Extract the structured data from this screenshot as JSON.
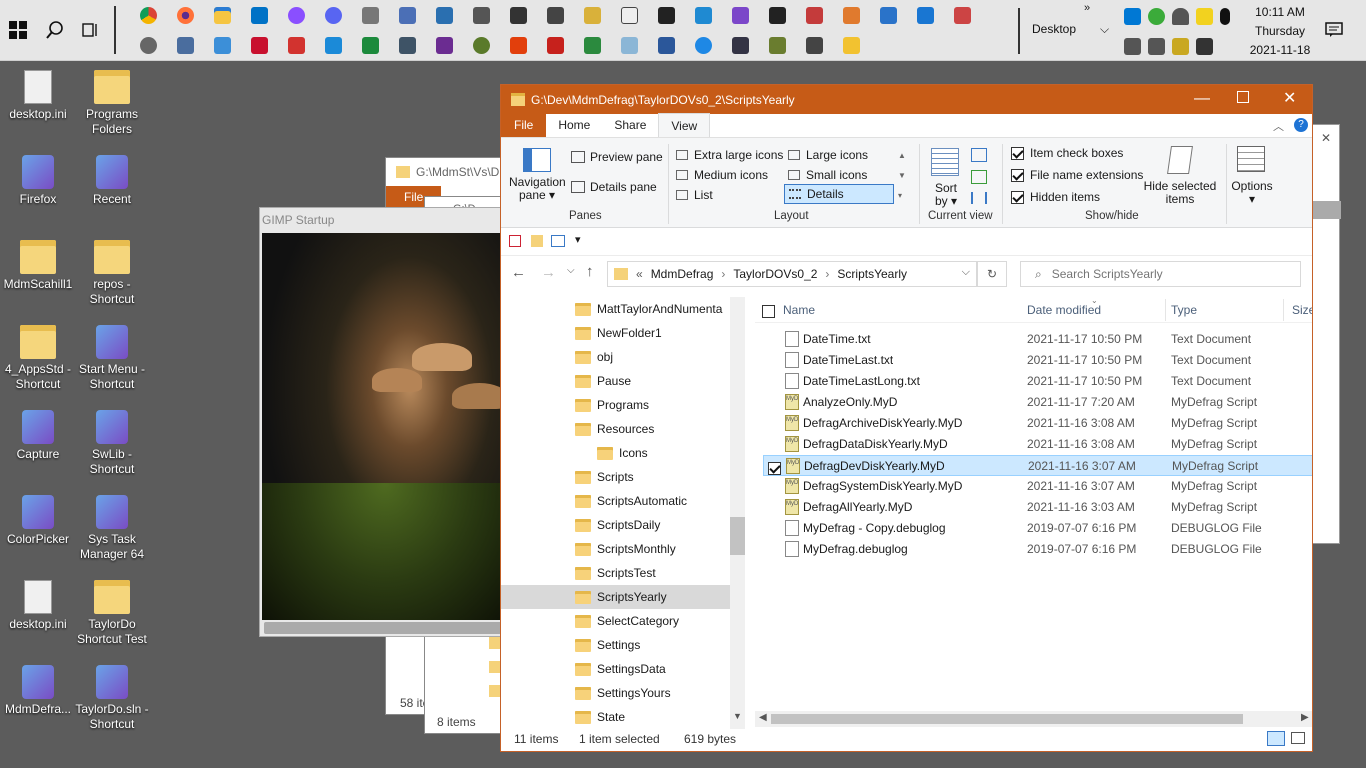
{
  "taskbar": {
    "search_icon": "search-icon",
    "desktop_label": "Desktop",
    "time": "10:11 AM",
    "day": "Thursday",
    "date": "2021-11-18",
    "overflow": "»"
  },
  "desktop_icons": [
    {
      "label": "desktop.ini",
      "type": "file"
    },
    {
      "label": "Programs Folders",
      "type": "folder"
    },
    {
      "label": "Firefox",
      "type": "app"
    },
    {
      "label": "Recent",
      "type": "app"
    },
    {
      "label": "MdmScahill1",
      "type": "folder"
    },
    {
      "label": "repos - Shortcut",
      "type": "folder"
    },
    {
      "label": "4_AppsStd - Shortcut",
      "type": "folder"
    },
    {
      "label": "Start Menu - Shortcut",
      "type": "app"
    },
    {
      "label": "Capture",
      "type": "app"
    },
    {
      "label": "SwLib - Shortcut",
      "type": "app"
    },
    {
      "label": "ColorPicker",
      "type": "app"
    },
    {
      "label": "Sys Task Manager 64",
      "type": "app"
    },
    {
      "label": "desktop.ini",
      "type": "file"
    },
    {
      "label": "TaylorDo Shortcut Test",
      "type": "folder"
    },
    {
      "label": "MdmDefra...",
      "type": "app"
    },
    {
      "label": "TaylorDo.sln - Shortcut",
      "type": "app"
    }
  ],
  "bg_windows": {
    "back_title": "G:\\MdmSt\\Vs\\D",
    "back_file_tab": "File",
    "back_status": "58 ite",
    "mid_title": "G:\\D",
    "mid_status": "8 items",
    "gimp_title": "GIMP Startup"
  },
  "explorer": {
    "title": "G:\\Dev\\MdmDefrag\\TaylorDOVs0_2\\ScriptsYearly",
    "tabs": [
      "File",
      "Home",
      "Share",
      "View"
    ],
    "active_tab": "View",
    "ribbon": {
      "nav_pane": "Navigation",
      "nav_pane2": "pane",
      "preview_pane": "Preview pane",
      "details_pane": "Details pane",
      "panes_group": "Panes",
      "layouts": [
        "Extra large icons",
        "Large icons",
        "Medium icons",
        "Small icons",
        "List",
        "Details"
      ],
      "selected_layout": "Details",
      "layout_group": "Layout",
      "sort_by": "Sort",
      "sort_by2": "by",
      "current_view_group": "Current view",
      "item_check_boxes": "Item check boxes",
      "file_name_extensions": "File name extensions",
      "hidden_items": "Hidden items",
      "hide_selected": "Hide selected",
      "hide_selected2": "items",
      "show_hide_group": "Show/hide",
      "options": "Options"
    },
    "address": {
      "prefix": "«",
      "crumbs": [
        "MdmDefrag",
        "TaylorDOVs0_2",
        "ScriptsYearly"
      ],
      "search_placeholder": "Search ScriptsYearly"
    },
    "nav_items": [
      {
        "label": "MattTaylorAndNumenta",
        "indent": 0
      },
      {
        "label": "NewFolder1",
        "indent": 0
      },
      {
        "label": "obj",
        "indent": 0
      },
      {
        "label": "Pause",
        "indent": 0
      },
      {
        "label": "Programs",
        "indent": 0
      },
      {
        "label": "Resources",
        "indent": 0
      },
      {
        "label": "Icons",
        "indent": 1
      },
      {
        "label": "Scripts",
        "indent": 0
      },
      {
        "label": "ScriptsAutomatic",
        "indent": 0
      },
      {
        "label": "ScriptsDaily",
        "indent": 0
      },
      {
        "label": "ScriptsMonthly",
        "indent": 0
      },
      {
        "label": "ScriptsTest",
        "indent": 0
      },
      {
        "label": "ScriptsYearly",
        "indent": 0,
        "selected": true
      },
      {
        "label": "SelectCategory",
        "indent": 0
      },
      {
        "label": "Settings",
        "indent": 0
      },
      {
        "label": "SettingsData",
        "indent": 0
      },
      {
        "label": "SettingsYours",
        "indent": 0
      },
      {
        "label": "State",
        "indent": 0
      }
    ],
    "columns": [
      "Name",
      "Date modified",
      "Type",
      "Size"
    ],
    "files": [
      {
        "name": "DateTime.txt",
        "date": "2021-11-17 10:50 PM",
        "type": "Text Document",
        "icon": "txt"
      },
      {
        "name": "DateTimeLast.txt",
        "date": "2021-11-17 10:50 PM",
        "type": "Text Document",
        "icon": "txt"
      },
      {
        "name": "DateTimeLastLong.txt",
        "date": "2021-11-17 10:50 PM",
        "type": "Text Document",
        "icon": "txt"
      },
      {
        "name": "AnalyzeOnly.MyD",
        "date": "2021-11-17 7:20 AM",
        "type": "MyDefrag Script",
        "icon": "myd"
      },
      {
        "name": "DefragArchiveDiskYearly.MyD",
        "date": "2021-11-16 3:08 AM",
        "type": "MyDefrag Script",
        "icon": "myd"
      },
      {
        "name": "DefragDataDiskYearly.MyD",
        "date": "2021-11-16 3:08 AM",
        "type": "MyDefrag Script",
        "icon": "myd"
      },
      {
        "name": "DefragDevDiskYearly.MyD",
        "date": "2021-11-16 3:07 AM",
        "type": "MyDefrag Script",
        "icon": "myd",
        "selected": true
      },
      {
        "name": "DefragSystemDiskYearly.MyD",
        "date": "2021-11-16 3:07 AM",
        "type": "MyDefrag Script",
        "icon": "myd"
      },
      {
        "name": "DefragAllYearly.MyD",
        "date": "2021-11-16 3:03 AM",
        "type": "MyDefrag Script",
        "icon": "myd"
      },
      {
        "name": "MyDefrag - Copy.debuglog",
        "date": "2019-07-07 6:16 PM",
        "type": "DEBUGLOG File",
        "icon": "txt"
      },
      {
        "name": "MyDefrag.debuglog",
        "date": "2019-07-07 6:16 PM",
        "type": "DEBUGLOG File",
        "icon": "txt"
      }
    ],
    "status": {
      "items": "11 items",
      "selected": "1 item selected",
      "size": "619 bytes"
    }
  },
  "colors": {
    "explorer_title": "#c65b17",
    "selection": "#cce8ff",
    "taskbar": "#e6e6e6"
  }
}
